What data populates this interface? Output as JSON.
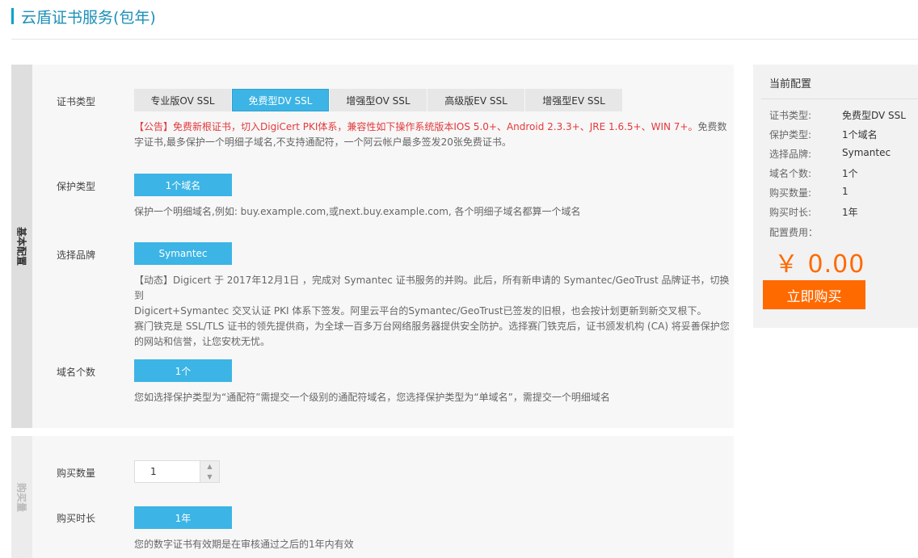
{
  "page": {
    "title": "云盾证书服务(包年)"
  },
  "basic": {
    "side_label": "基本配置",
    "cert_type": {
      "label": "证书类型",
      "options": [
        "专业版OV SSL",
        "免费型DV SSL",
        "增强型OV SSL",
        "高级版EV SSL",
        "增强型EV SSL"
      ],
      "selected": "免费型DV SSL",
      "notice": "【公告】免费新根证书，切入DigiCert PKI体系，兼容性如下操作系统版本IOS 5.0+、Android 2.3.3+、JRE 1.6.5+、WIN 7+。",
      "desc": "免费数字证书,最多保护一个明细子域名,不支持通配符，一个阿云帐户最多签发20张免费证书。"
    },
    "protect_type": {
      "label": "保护类型",
      "value": "1个域名",
      "desc": "保护一个明细域名,例如: buy.example.com,或next.buy.example.com, 各个明细子域名都算一个域名"
    },
    "brand": {
      "label": "选择品牌",
      "value": "Symantec",
      "desc_line1": "【动态】Digicert 于 2017年12月1日 ，完成对 Symantec 证书服务的并购。此后，所有新申请的 Symantec/GeoTrust 品牌证书，切换到",
      "desc_line2": "Digicert+Symantec 交叉认证 PKI 体系下签发。阿里云平台的Symantec/GeoTrust已签发的旧根，也会按计划更新到新交叉根下。",
      "desc_line3": "赛门铁克是 SSL/TLS 证书的领先提供商，为全球一百多万台网络服务器提供安全防护。选择赛门铁克后，证书颁发机构 (CA) 将妥善保护您",
      "desc_line4": "的网站和信誉，让您安枕无忧。"
    },
    "domain_count": {
      "label": "域名个数",
      "value": "1个",
      "desc": "您如选择保护类型为“通配符”需提交一个级别的通配符域名，您选择保护类型为“单域名”，需提交一个明细域名"
    }
  },
  "purchase": {
    "side_label": "购买量",
    "quantity": {
      "label": "购买数量",
      "value": "1"
    },
    "duration": {
      "label": "购买时长",
      "value": "1年",
      "desc": "您的数字证书有效期是在审核通过之后的1年内有效"
    }
  },
  "summary": {
    "title": "当前配置",
    "rows": [
      {
        "k": "证书类型:",
        "v": "免费型DV SSL"
      },
      {
        "k": "保护类型:",
        "v": "1个域名"
      },
      {
        "k": "选择品牌:",
        "v": "Symantec"
      },
      {
        "k": "域名个数:",
        "v": "1个"
      },
      {
        "k": "购买数量:",
        "v": "1"
      },
      {
        "k": "购买时长:",
        "v": "1年"
      }
    ],
    "fee_label": "配置费用：",
    "price": "￥ 0.00",
    "buy_button": "立即购买"
  },
  "colors": {
    "accent": "#3cb4e5",
    "title": "#1d90b8",
    "price": "#ff6a00",
    "notice": "#e4393c"
  }
}
